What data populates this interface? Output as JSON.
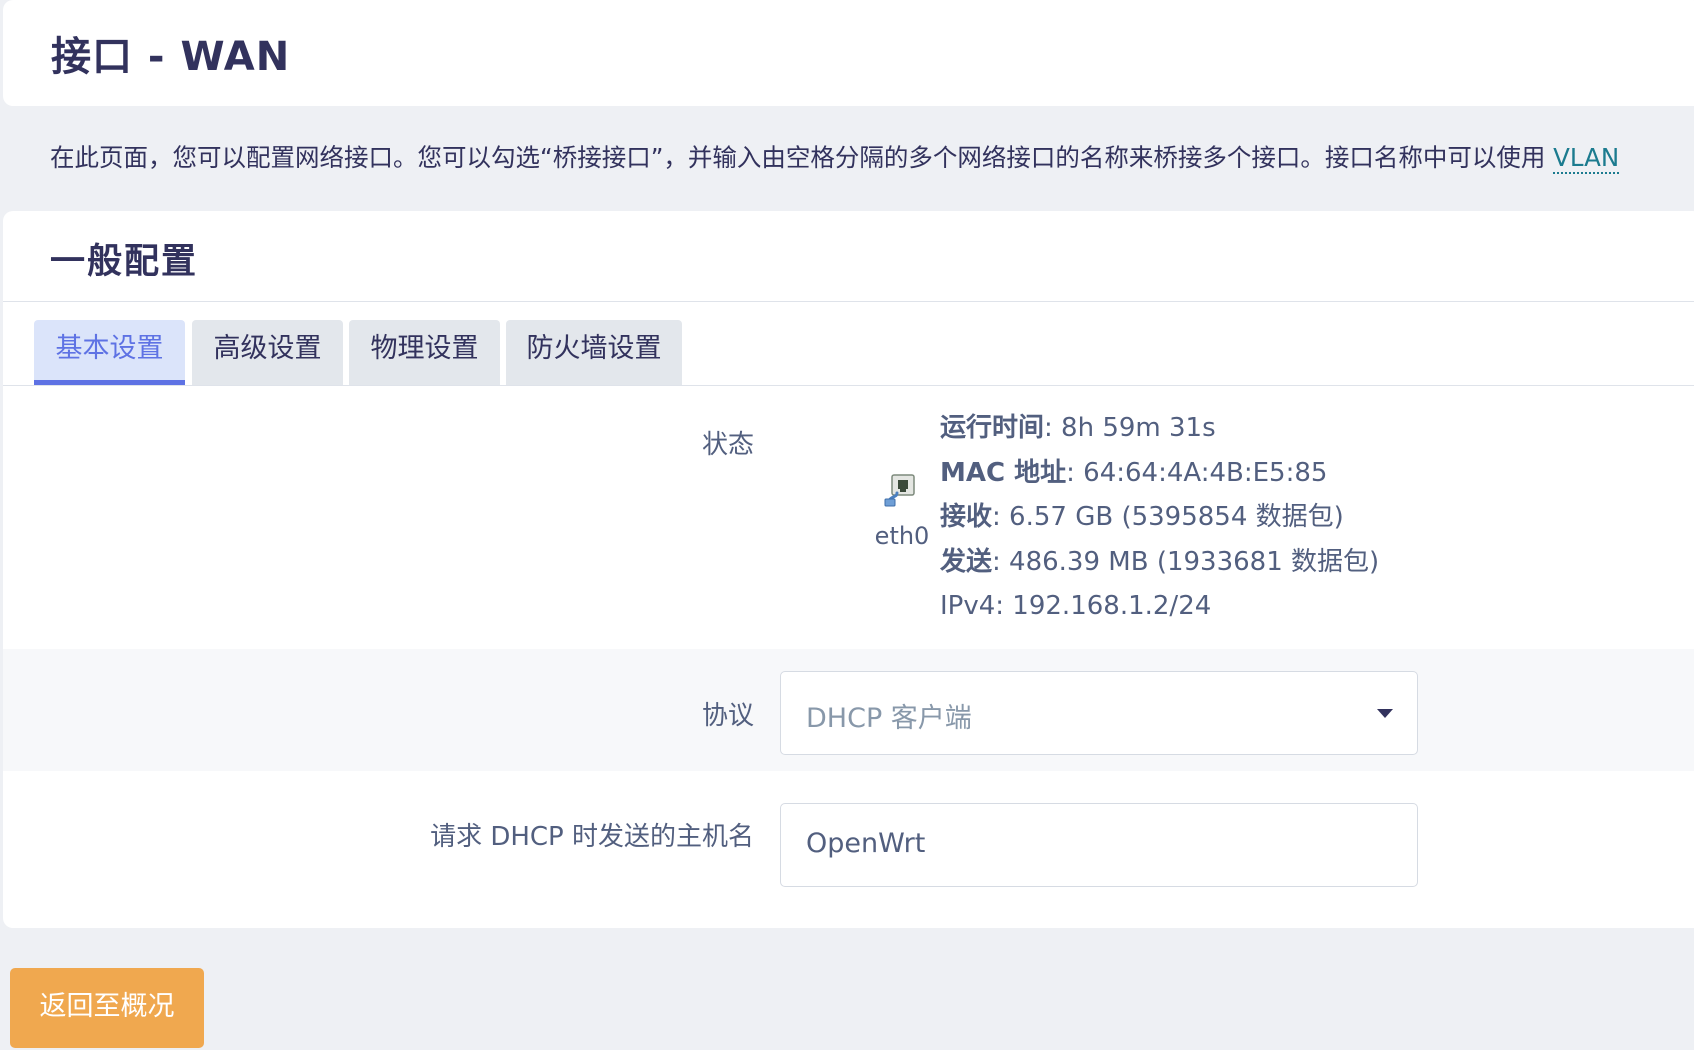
{
  "header": {
    "title": "接口 - WAN"
  },
  "description": {
    "text": "在此页面，您可以配置网络接口。您可以勾选“桥接接口”，并输入由空格分隔的多个网络接口的名称来桥接多个接口。接口名称中可以使用 ",
    "link": "VLAN"
  },
  "section": {
    "title": "一般配置"
  },
  "tabs": [
    {
      "label": "基本设置",
      "active": true
    },
    {
      "label": "高级设置",
      "active": false
    },
    {
      "label": "物理设置",
      "active": false
    },
    {
      "label": "防火墙设置",
      "active": false
    }
  ],
  "status": {
    "label": "状态",
    "device": {
      "name": "eth0",
      "icon": "ethernet-port-icon"
    },
    "lines": [
      {
        "key": "运行时间",
        "value": ": 8h 59m 31s"
      },
      {
        "key": "MAC 地址",
        "value": ": 64:64:4A:4B:E5:85"
      },
      {
        "key": "接收",
        "value": ": 6.57 GB (5395854 数据包)"
      },
      {
        "key": "发送",
        "value": ": 486.39 MB (1933681 数据包)"
      },
      {
        "key": "",
        "value": "IPv4: 192.168.1.2/24"
      }
    ]
  },
  "protocol": {
    "label": "协议",
    "selected": "DHCP 客户端"
  },
  "hostname": {
    "label": "请求 DHCP 时发送的主机名",
    "value": "OpenWrt"
  },
  "footer": {
    "back_label": "返回至概况"
  },
  "colors": {
    "accent": "#5e72e4",
    "back_button": "#f0a84f",
    "link": "#1b7b8f",
    "text": "#32325d"
  }
}
